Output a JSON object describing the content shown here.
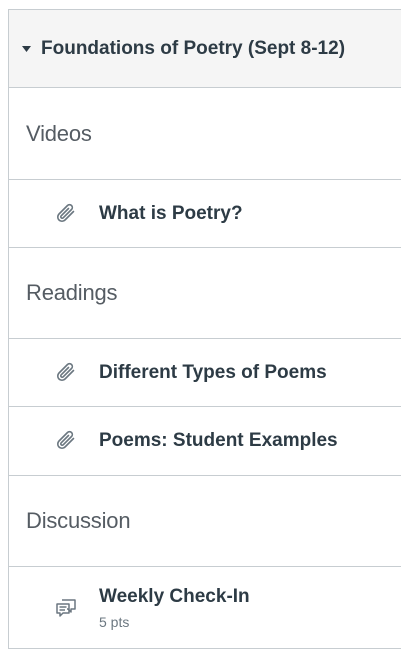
{
  "module": {
    "title": "Foundations of Poetry (Sept 8-12)",
    "toggle_icon": "caret-down-icon"
  },
  "sections": [
    {
      "heading": "Videos",
      "items": [
        {
          "icon": "paperclip-icon",
          "title": "What is Poetry?"
        }
      ]
    },
    {
      "heading": "Readings",
      "items": [
        {
          "icon": "paperclip-icon",
          "title": "Different Types of Poems"
        },
        {
          "icon": "paperclip-icon",
          "title": "Poems: Student Examples"
        }
      ]
    },
    {
      "heading": "Discussion",
      "items": [
        {
          "icon": "discussion-icon",
          "title": "Weekly Check-In",
          "meta": "5 pts"
        }
      ]
    }
  ],
  "colors": {
    "border": "#c7cdd1",
    "header_bg": "#f5f5f5",
    "text": "#2d3b45",
    "subheader_text": "#555c63"
  }
}
